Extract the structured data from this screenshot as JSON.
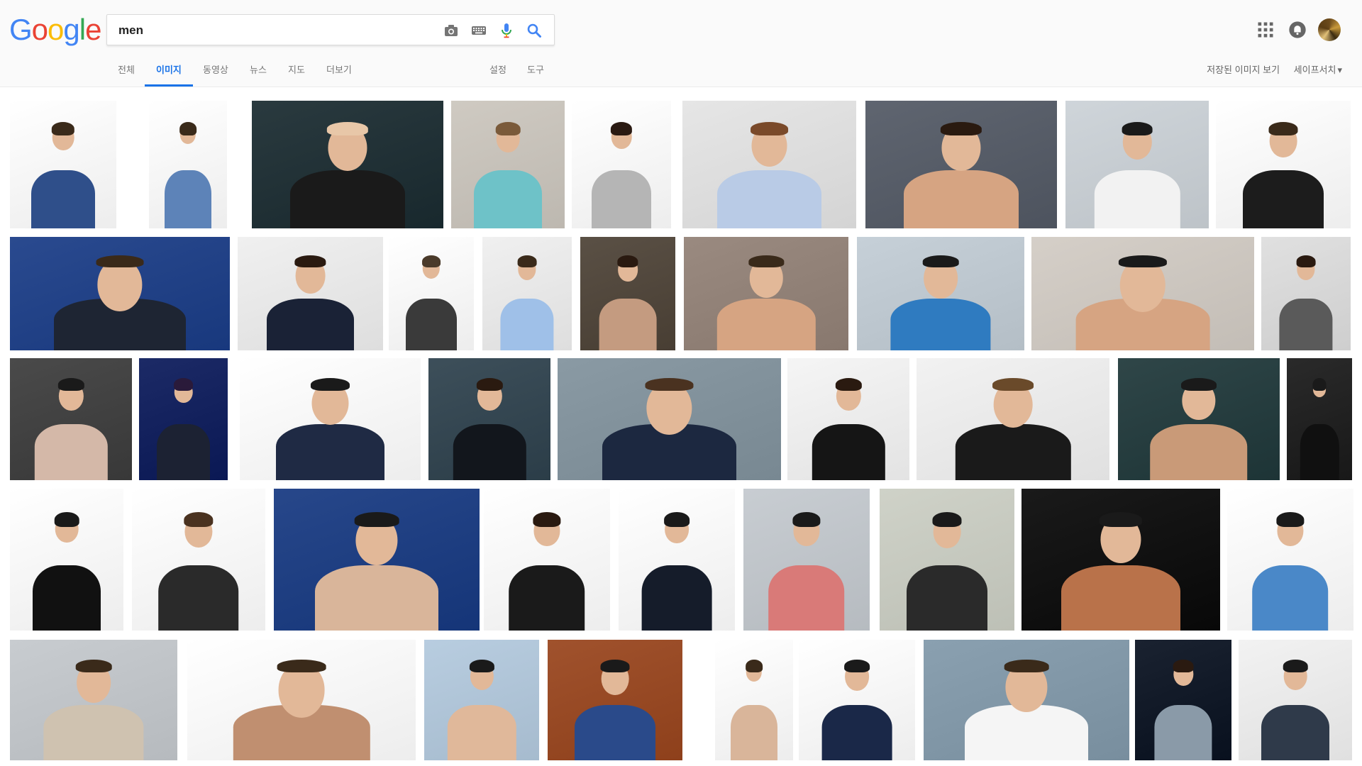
{
  "logo": {
    "text": "Google",
    "letters": [
      "G",
      "o",
      "o",
      "g",
      "l",
      "e"
    ],
    "colors": [
      "#4285f4",
      "#ea4335",
      "#fbbc05",
      "#4285f4",
      "#34a853",
      "#ea4335"
    ]
  },
  "search": {
    "query": "men",
    "camera_icon": "camera-icon",
    "keyboard_icon": "keyboard-icon",
    "mic_icon": "microphone-icon",
    "search_icon": "search-icon"
  },
  "header_right": {
    "apps_icon": "apps-grid-icon",
    "notifications_icon": "notifications-icon",
    "avatar": "account-avatar"
  },
  "tabs": [
    {
      "label": "전체",
      "active": false
    },
    {
      "label": "이미지",
      "active": true
    },
    {
      "label": "동영상",
      "active": false
    },
    {
      "label": "뉴스",
      "active": false
    },
    {
      "label": "지도",
      "active": false
    },
    {
      "label": "더보기",
      "active": false
    },
    {
      "label": "설정",
      "active": false
    },
    {
      "label": "도구",
      "active": false
    }
  ],
  "right_links": {
    "saved_images": "저장된 이미지 보기",
    "safesearch": "세이프서치",
    "safesearch_caret": "▾"
  },
  "colors": {
    "accent": "#1a73e8",
    "header_bg": "#fafafa"
  },
  "results": {
    "rows": 5,
    "thumbnail_subject": "men",
    "thumbnail_themes": [
      [
        "#ffffff",
        "#2f4f8a",
        "#3a2a1a"
      ],
      [
        "#ffffff",
        "#5d83b8",
        "#3a2a1a"
      ],
      [
        "#2a3a3f",
        "#1a1a1a",
        "#e8c7a8"
      ],
      [
        "#cfcac2",
        "#6ec2c8",
        "#7a5a3a"
      ],
      [
        "#ffffff",
        "#b5b5b5",
        "#2a1a12"
      ],
      [
        "#e6e6e6",
        "#b9cbe6",
        "#7a4a2a"
      ],
      [
        "#5f6570",
        "#d6a482",
        "#2a1a10"
      ],
      [
        "#cfd5da",
        "#f2f2f2",
        "#1a1a1a"
      ],
      [
        "#ffffff",
        "#1c1c1c",
        "#3a2a1a"
      ],
      [
        "#2a4a8f",
        "#1e2533",
        "#3a2a1a"
      ],
      [
        "#f0f0f0",
        "#1a2236",
        "#2a1a10"
      ],
      [
        "#ffffff",
        "#3a3a3a",
        "#4a3a2a"
      ],
      [
        "#f0f0f0",
        "#9fc0e8",
        "#3a2a1a"
      ],
      [
        "#5a5045",
        "#c49b80",
        "#2a1a10"
      ],
      [
        "#9a8a80",
        "#d6a482",
        "#3a2a1a"
      ],
      [
        "#c6d0d8",
        "#2f7bc0",
        "#1a1a1a"
      ],
      [
        "#d5cfc8",
        "#d6a482",
        "#1a1a1a"
      ],
      [
        "#e0e0e0",
        "#5a5a5a",
        "#2a1a10"
      ],
      [
        "#4a4a4a",
        "#d4b8a8",
        "#1a1a1a"
      ],
      [
        "#1c2a66",
        "#1c2233",
        "#2a1a3a"
      ],
      [
        "#ffffff",
        "#1f2a44",
        "#1a1a1a"
      ],
      [
        "#3d4f5a",
        "#12161c",
        "#2a1a10"
      ],
      [
        "#8a9aa4",
        "#1c2840",
        "#4a3220"
      ],
      [
        "#f5f5f5",
        "#151515",
        "#2a1a10"
      ],
      [
        "#f2f2f2",
        "#1a1a1a",
        "#6a4a2a"
      ],
      [
        "#2f4648",
        "#c99a78",
        "#1a1a1a"
      ],
      [
        "#2a2a2a",
        "#101010",
        "#1a1a1a"
      ],
      [
        "#ffffff",
        "#111111",
        "#1a1a1a"
      ],
      [
        "#ffffff",
        "#2a2a2a",
        "#4a3220"
      ],
      [
        "#27478a",
        "#d9b59a",
        "#1a1a1a"
      ],
      [
        "#ffffff",
        "#1a1a1a",
        "#2a1a10"
      ],
      [
        "#ffffff",
        "#151c2a",
        "#1a1a1a"
      ],
      [
        "#c8cdd2",
        "#d97a78",
        "#1a1a1a"
      ],
      [
        "#cfd2c8",
        "#2a2a2a",
        "#1a1a1a"
      ],
      [
        "#1a1a1a",
        "#b9724a",
        "#1a1a1a"
      ],
      [
        "#ffffff",
        "#4a88c8",
        "#1a1a1a"
      ],
      [
        "#c8ccd0",
        "#cfc2b0",
        "#3a2a1a"
      ],
      [
        "#ffffff",
        "#c08f70",
        "#3a2a1a"
      ],
      [
        "#b8cde0",
        "#e0b89a",
        "#1a1a1a"
      ],
      [
        "#a0522d",
        "#2a4a8a",
        "#1a1a1a"
      ],
      [
        "#ffffff",
        "#d9b59a",
        "#3a2a1a"
      ],
      [
        "#ffffff",
        "#1a2848",
        "#1a1a1a"
      ],
      [
        "#8aa0b0",
        "#f5f5f5",
        "#3a2a1a"
      ],
      [
        "#1a2230",
        "#8a9aa8",
        "#2a1a10"
      ],
      [
        "#f2f2f2",
        "#2f3a4a",
        "#1a1a1a"
      ],
      [
        "#ffffff",
        "#1a2236",
        "#1a1a1a"
      ]
    ]
  }
}
